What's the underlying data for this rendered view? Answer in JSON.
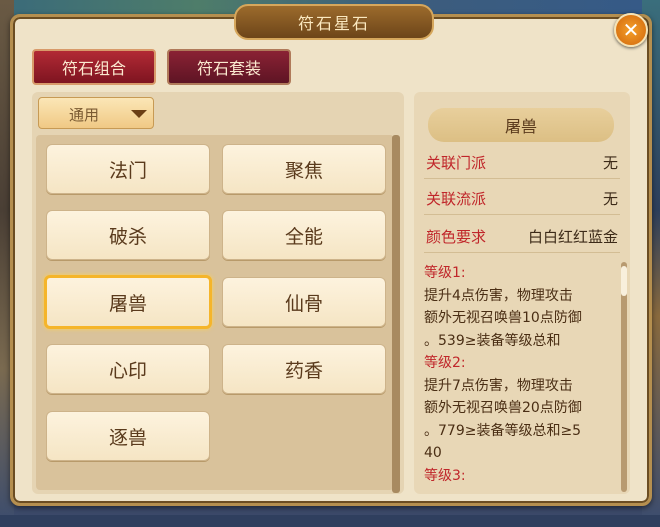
{
  "window": {
    "title": "符石星石",
    "close_symbol": "✕"
  },
  "tabs": [
    {
      "label": "符石组合"
    },
    {
      "label": "符石套装"
    }
  ],
  "filter": {
    "selected": "通用"
  },
  "cards": [
    {
      "label": "法门"
    },
    {
      "label": "聚焦"
    },
    {
      "label": "破杀"
    },
    {
      "label": "全能"
    },
    {
      "label": "屠兽"
    },
    {
      "label": "仙骨"
    },
    {
      "label": "心印"
    },
    {
      "label": "药香"
    },
    {
      "label": "逐兽"
    }
  ],
  "selected_card": "屠兽",
  "detail": {
    "name": "屠兽",
    "rows": [
      {
        "label": "关联门派",
        "value": "无"
      },
      {
        "label": "关联流派",
        "value": "无"
      },
      {
        "label": "颜色要求",
        "value": "白白红红蓝金"
      }
    ],
    "levels": [
      {
        "title": "等级1:",
        "lines": [
          "提升4点伤害，物理攻击",
          "额外无视召唤兽10点防御",
          "。539≥装备等级总和"
        ]
      },
      {
        "title": "等级2:",
        "lines": [
          "提升7点伤害，物理攻击",
          "额外无视召唤兽20点防御",
          "。779≥装备等级总和≥5",
          "40"
        ]
      },
      {
        "title": "等级3:",
        "lines": []
      }
    ]
  },
  "colors": {
    "accent_red": "#c0262a",
    "selected_border": "#f5b52a",
    "close": "#d0660c"
  }
}
